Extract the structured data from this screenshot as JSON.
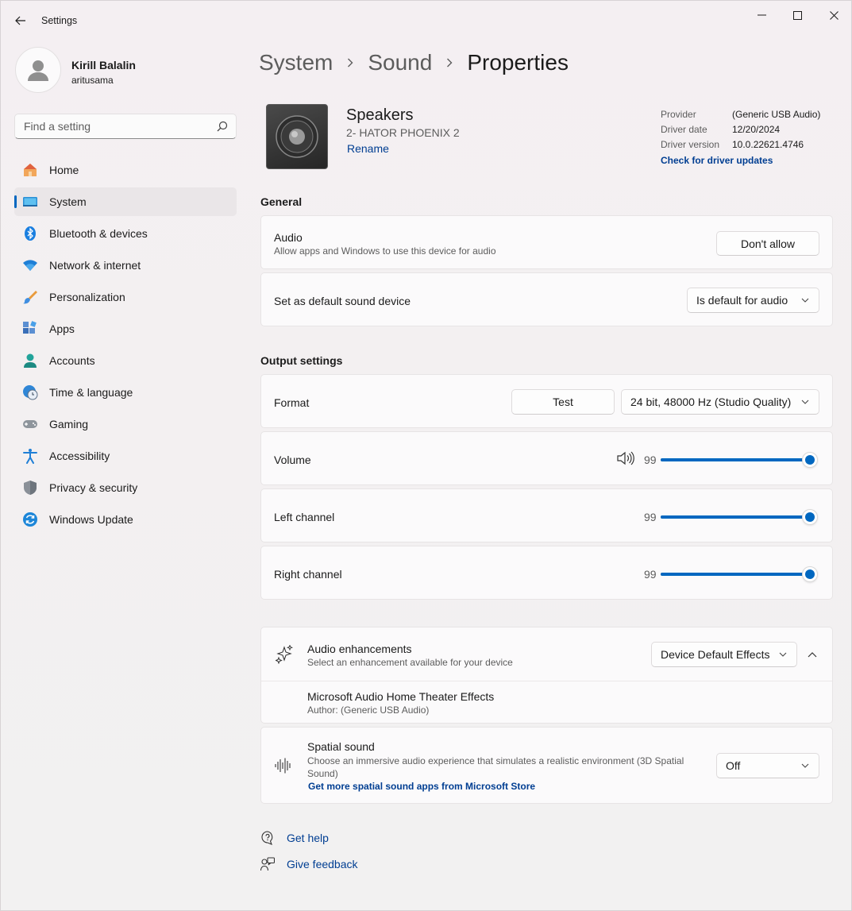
{
  "window": {
    "title": "Settings",
    "controls": [
      "minimize",
      "maximize",
      "close"
    ]
  },
  "profile": {
    "name": "Kirill Balalin",
    "account": "aritusama"
  },
  "search": {
    "placeholder": "Find a setting"
  },
  "sidebar": {
    "items": [
      {
        "label": "Home",
        "icon": "home-icon"
      },
      {
        "label": "System",
        "icon": "system-icon",
        "selected": true
      },
      {
        "label": "Bluetooth & devices",
        "icon": "bluetooth-icon"
      },
      {
        "label": "Network & internet",
        "icon": "wifi-icon"
      },
      {
        "label": "Personalization",
        "icon": "brush-icon"
      },
      {
        "label": "Apps",
        "icon": "apps-icon"
      },
      {
        "label": "Accounts",
        "icon": "accounts-icon"
      },
      {
        "label": "Time & language",
        "icon": "clock-globe-icon"
      },
      {
        "label": "Gaming",
        "icon": "gamepad-icon"
      },
      {
        "label": "Accessibility",
        "icon": "accessibility-icon"
      },
      {
        "label": "Privacy & security",
        "icon": "shield-icon"
      },
      {
        "label": "Windows Update",
        "icon": "update-icon"
      }
    ]
  },
  "breadcrumb": {
    "parts": [
      "System",
      "Sound"
    ],
    "current": "Properties"
  },
  "device": {
    "name": "Speakers",
    "model": "2- HATOR PHOENIX 2",
    "rename_label": "Rename",
    "driver": {
      "provider_label": "Provider",
      "provider": "(Generic USB Audio)",
      "date_label": "Driver date",
      "date": "12/20/2024",
      "version_label": "Driver version",
      "version": "10.0.22621.4746",
      "update_link": "Check for driver updates"
    }
  },
  "general": {
    "title": "General",
    "audio": {
      "title": "Audio",
      "subtitle": "Allow apps and Windows to use this device for audio",
      "button": "Don't allow"
    },
    "default_device": {
      "title": "Set as default sound device",
      "value": "Is default for audio"
    }
  },
  "output": {
    "title": "Output settings",
    "format": {
      "title": "Format",
      "test_button": "Test",
      "value": "24 bit, 48000 Hz (Studio Quality)"
    },
    "volume": {
      "title": "Volume",
      "value": "99",
      "level": 0.99
    },
    "left_channel": {
      "title": "Left channel",
      "value": "99",
      "level": 0.99
    },
    "right_channel": {
      "title": "Right channel",
      "value": "99",
      "level": 0.99
    }
  },
  "enhancements": {
    "title": "Audio enhancements",
    "subtitle": "Select an enhancement available for your device",
    "value": "Device Default Effects",
    "expanded": true,
    "effect": {
      "title": "Microsoft Audio Home Theater Effects",
      "author": "Author: (Generic USB Audio)"
    }
  },
  "spatial": {
    "title": "Spatial sound",
    "subtitle": "Choose an immersive audio experience that simulates a realistic environment (3D Spatial Sound)",
    "link": "Get more spatial sound apps from Microsoft Store",
    "value": "Off"
  },
  "footer": {
    "help": "Get help",
    "feedback": "Give feedback"
  },
  "colors": {
    "accent": "#0067c0",
    "link": "#003e92"
  }
}
